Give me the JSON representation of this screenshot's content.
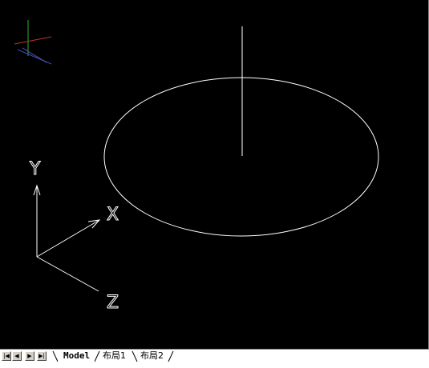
{
  "viewport": {
    "background": "#000000",
    "ucs_axis_labels": {
      "x": "X",
      "y": "Y",
      "z": "Z"
    },
    "view_cube_colors": {
      "x": "#d04040",
      "y": "#40c040",
      "z": "#4060e0"
    },
    "drawing_color": "#ffffff"
  },
  "tabbar": {
    "nav_buttons": [
      {
        "name": "first-tab",
        "icon": "skip-first-icon"
      },
      {
        "name": "previous-tab",
        "icon": "prev-icon"
      },
      {
        "name": "next-tab",
        "icon": "next-icon"
      },
      {
        "name": "last-tab",
        "icon": "skip-last-icon"
      }
    ],
    "tabs": [
      {
        "label": "Model",
        "active": true
      },
      {
        "label": "布局1",
        "active": false
      },
      {
        "label": "布局2",
        "active": false
      }
    ]
  }
}
